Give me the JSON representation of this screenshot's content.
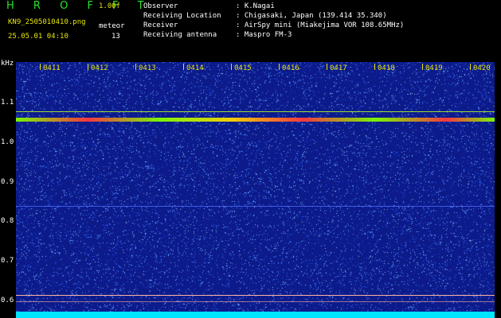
{
  "header": {
    "app_title": "H R O F F T",
    "version": "1.00f",
    "file_name": "KN9_2505010410.png",
    "meteor_label": "meteor",
    "date_time": "25.05.01 04:10",
    "meteor_count": "13"
  },
  "info": [
    {
      "label": "Observer",
      "value": ": K.Nagai"
    },
    {
      "label": "Receiving Location",
      "value": ": Chigasaki, Japan (139.414 35.340)"
    },
    {
      "label": "Receiver",
      "value": ": AirSpy mini (Miakejima VOR 108.65MHz)"
    },
    {
      "label": "Receiving antenna",
      "value": ": Maspro FM-3"
    }
  ],
  "spectrogram": {
    "y_unit": "kHz",
    "y_ticks": [
      "1.1",
      "1.0",
      "0.9",
      "0.8",
      "0.7",
      "0.6"
    ],
    "time_labels": [
      "0411",
      "0412",
      "0413",
      "0414",
      "0415",
      "0416",
      "0417",
      "0418",
      "0419",
      "0420"
    ],
    "colors": {
      "background": "#0c1a8a",
      "signal": "#7fff00",
      "bottom_band": "#00e5ff"
    }
  }
}
